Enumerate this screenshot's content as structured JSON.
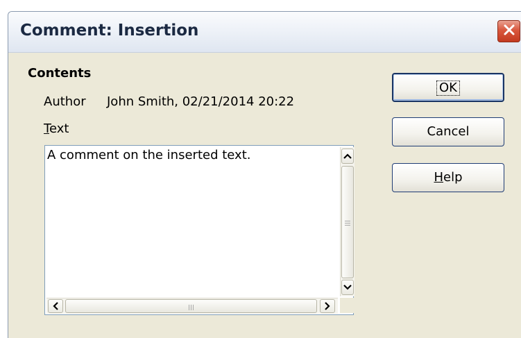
{
  "dialog": {
    "title": "Comment: Insertion",
    "close_icon": "close-icon"
  },
  "contents": {
    "section_label": "Contents",
    "author_label": "Author",
    "author_value": "John Smith, 02/21/2014 20:22",
    "text_label_mnemonic": "T",
    "text_label_rest": "ext",
    "text_value": "A comment on the inserted text."
  },
  "buttons": {
    "ok": "OK",
    "cancel": "Cancel",
    "help_mnemonic": "H",
    "help_rest": "elp"
  },
  "colors": {
    "dialog_bg": "#ece9d8",
    "close_button": "#d9573d",
    "button_border": "#1f3c74"
  }
}
